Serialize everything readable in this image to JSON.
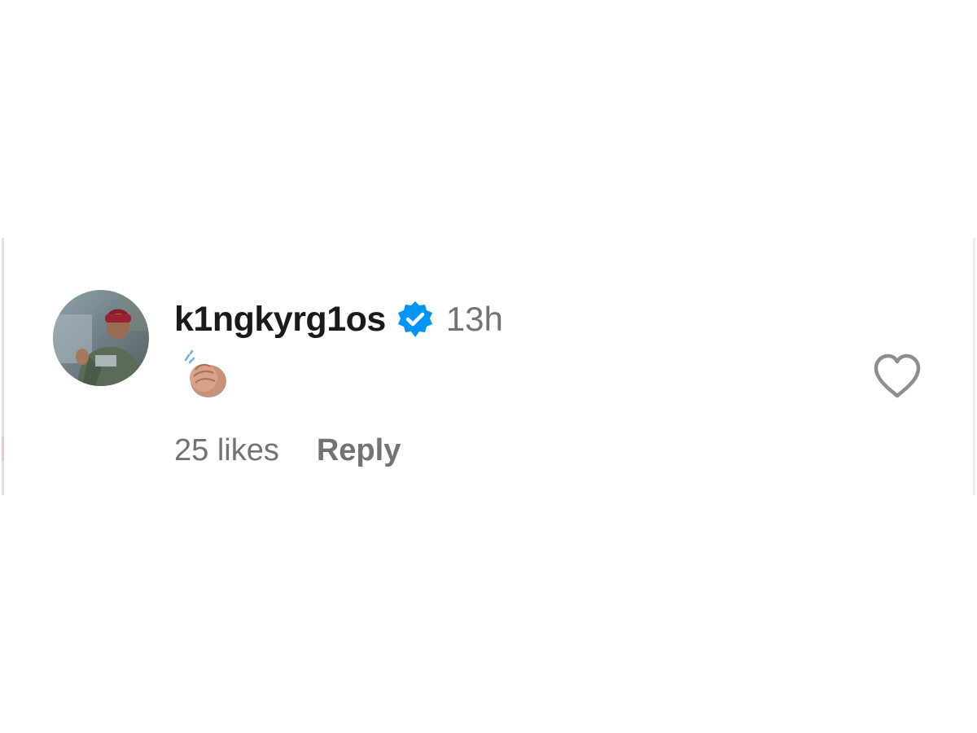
{
  "comment": {
    "username": "k1ngkyrg1os",
    "verified": true,
    "timestamp": "13h",
    "content_emoji": "clapping-hands-medium-skin-tone",
    "likes_label": "25 likes",
    "reply_label": "Reply"
  },
  "icons": {
    "verified": "verified-badge-icon",
    "like": "heart-outline-icon",
    "avatar": "profile-photo"
  },
  "colors": {
    "username": "#1a1a1a",
    "secondary_text": "#737373",
    "verified_blue": "#0095f6",
    "heart_outline": "#8e8e8e",
    "background": "#ffffff"
  }
}
